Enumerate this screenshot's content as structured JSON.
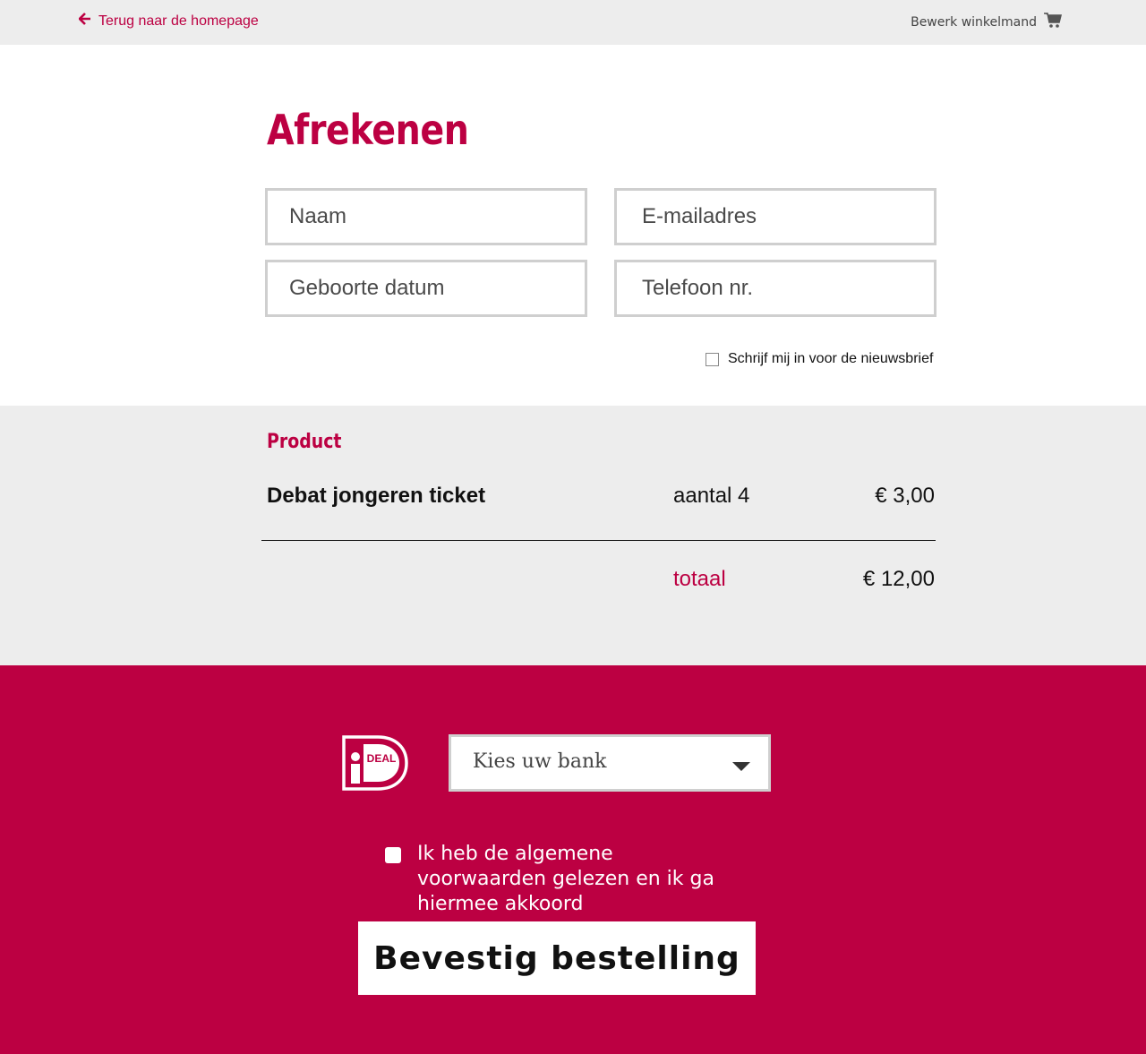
{
  "header": {
    "back_label": "Terug naar de homepage",
    "cart_label": "Bewerk winkelmand"
  },
  "page": {
    "title": "Afrekenen"
  },
  "form": {
    "name_placeholder": "Naam",
    "email_placeholder": "E-mailadres",
    "birthdate_placeholder": "Geboorte datum",
    "phone_placeholder": "Telefoon nr.",
    "newsletter_label": "Schrijf mij in voor de nieuwsbrief"
  },
  "summary": {
    "heading": "Product",
    "item": {
      "name": "Debat jongeren ticket",
      "quantity": "aantal 4",
      "price": "€ 3,00"
    },
    "total_label": "totaal",
    "total_value": "€ 12,00"
  },
  "payment": {
    "logo_text": "DEAL",
    "bank_select_label": "Kies uw bank",
    "terms_label": "Ik heb de algemene voorwaarden gelezen en ik ga hiermee akkoord",
    "confirm_label": "Bevestig bestelling"
  },
  "colors": {
    "brand": "#bc0042",
    "panel": "#ededed",
    "field_border": "#cfcfcf"
  }
}
